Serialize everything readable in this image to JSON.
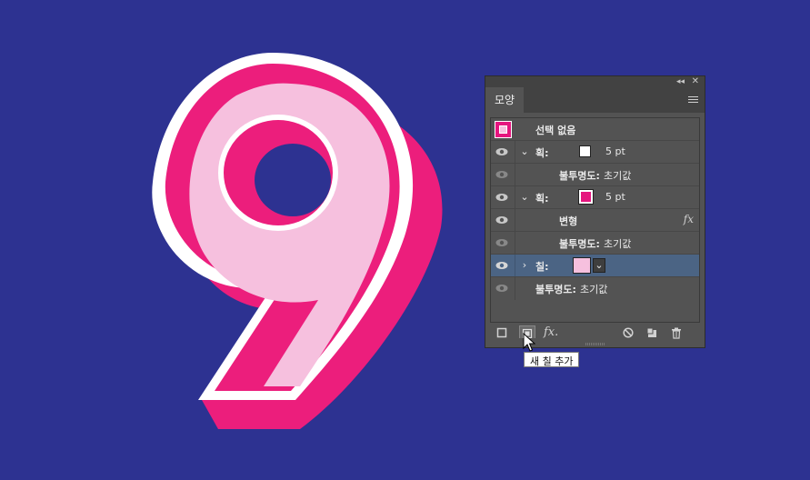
{
  "colors": {
    "background": "#2d3291",
    "pink": "#ec1e7c",
    "light_pink": "#f6c0de",
    "white": "#ffffff",
    "selected_row": "#4b6484"
  },
  "artwork": {
    "glyph": "9"
  },
  "panel": {
    "tab_label": "모양",
    "rows": [
      {
        "type": "thumbnail",
        "label": "선택 없음"
      },
      {
        "type": "stroke",
        "label": "획:",
        "swatch": "#ffffff",
        "value": "5 pt"
      },
      {
        "type": "opacity",
        "label": "불투명도:",
        "value": "초기값"
      },
      {
        "type": "stroke",
        "label": "획:",
        "swatch": "#e5157e",
        "value": "5 pt"
      },
      {
        "type": "effect",
        "label": "변형"
      },
      {
        "type": "opacity",
        "label": "불투명도:",
        "value": "초기값"
      },
      {
        "type": "fill",
        "label": "칠:",
        "swatch": "#f6c0de"
      },
      {
        "type": "opacity",
        "label": "불투명도:",
        "value": "초기값"
      }
    ],
    "fx_label": "fx"
  },
  "tooltip": "새 칠 추가"
}
